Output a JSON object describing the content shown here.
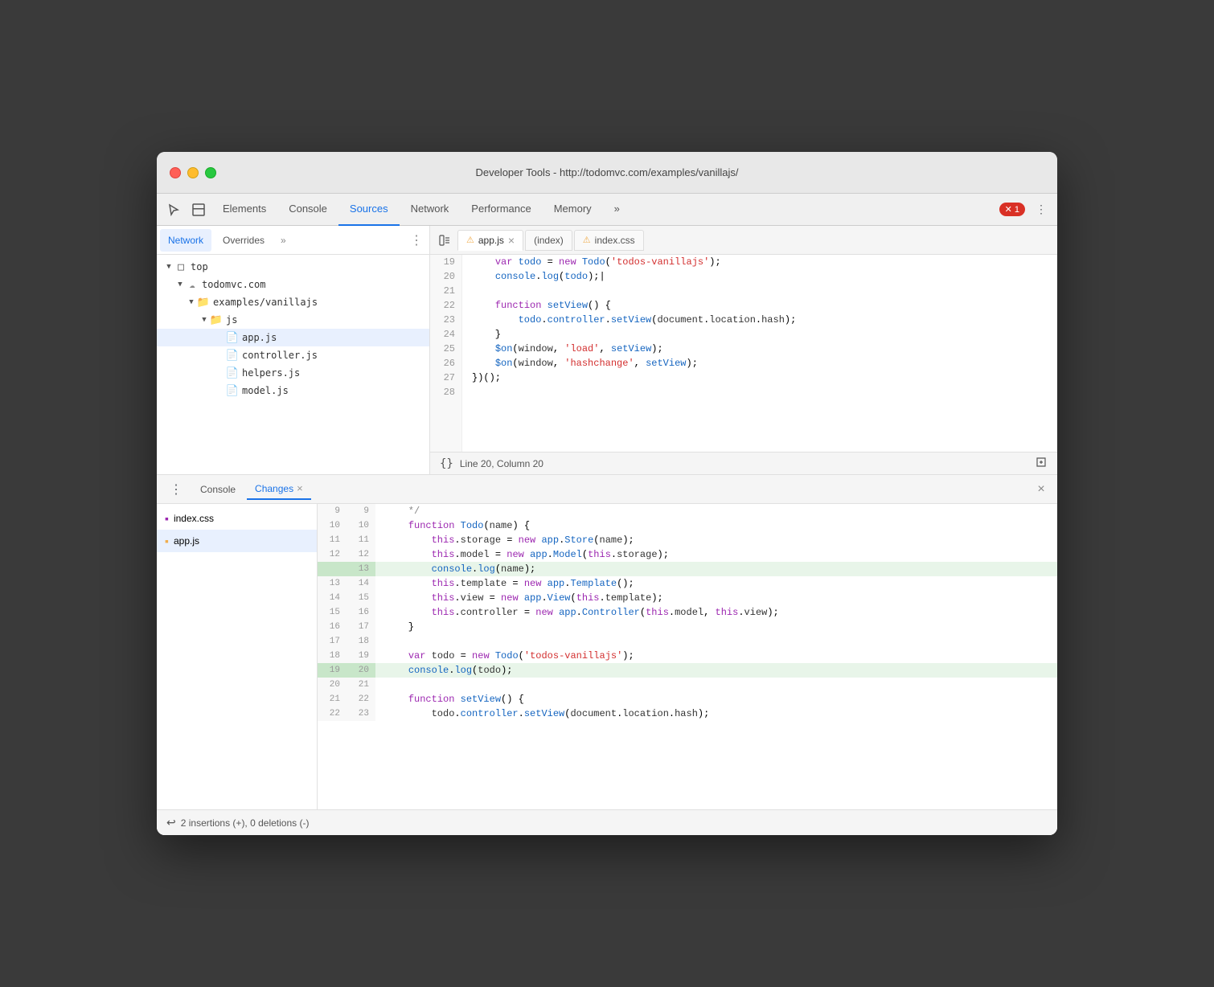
{
  "window": {
    "title": "Developer Tools - http://todomvc.com/examples/vanillajs/"
  },
  "traffic_lights": {
    "red": "close",
    "yellow": "minimize",
    "green": "maximize"
  },
  "main_tabs": [
    {
      "label": "Elements",
      "active": false
    },
    {
      "label": "Console",
      "active": false
    },
    {
      "label": "Sources",
      "active": true
    },
    {
      "label": "Network",
      "active": false
    },
    {
      "label": "Performance",
      "active": false
    },
    {
      "label": "Memory",
      "active": false
    },
    {
      "label": "»",
      "active": false
    }
  ],
  "error_badge": "1",
  "sources_panel_tabs": [
    {
      "label": "Network",
      "active": true
    },
    {
      "label": "Overrides",
      "active": false
    },
    {
      "label": "»",
      "active": false
    }
  ],
  "file_tree": {
    "top": {
      "label": "top",
      "expanded": true,
      "children": {
        "todomvc": {
          "label": "todomvc.com",
          "expanded": true,
          "children": {
            "examples": {
              "label": "examples/vanillajs",
              "expanded": true,
              "children": {
                "js": {
                  "label": "js",
                  "expanded": true,
                  "files": [
                    "app.js",
                    "controller.js",
                    "helpers.js",
                    "model.js"
                  ]
                }
              }
            }
          }
        }
      }
    }
  },
  "code_tabs": [
    {
      "label": "app.js",
      "warn": true,
      "active": true,
      "closeable": true
    },
    {
      "label": "(index)",
      "warn": false,
      "active": false,
      "closeable": false
    },
    {
      "label": "index.css",
      "warn": true,
      "active": false,
      "closeable": false
    }
  ],
  "code_lines": [
    {
      "num": 19,
      "content": "    var todo = new Todo('todos-vanillajs');"
    },
    {
      "num": 20,
      "content": "    console.log(todo);|"
    },
    {
      "num": 21,
      "content": ""
    },
    {
      "num": 22,
      "content": "    function setView() {"
    },
    {
      "num": 23,
      "content": "        todo.controller.setView(document.location.hash);"
    },
    {
      "num": 24,
      "content": "    }"
    },
    {
      "num": 25,
      "content": "    $on(window, 'load', setView);"
    },
    {
      "num": 26,
      "content": "    $on(window, 'hashchange', setView);"
    },
    {
      "num": 27,
      "content": "})();"
    },
    {
      "num": 28,
      "content": ""
    }
  ],
  "status_bar": {
    "line": "Line 20, Column 20"
  },
  "bottom_tabs": [
    {
      "label": "Console",
      "active": false
    },
    {
      "label": "Changes",
      "active": true,
      "closeable": true
    }
  ],
  "changed_files": [
    {
      "name": "index.css",
      "type": "css",
      "selected": false
    },
    {
      "name": "app.js",
      "type": "js",
      "selected": true
    }
  ],
  "diff_lines": [
    {
      "old_num": "9",
      "new_num": "9",
      "content": "    */",
      "added": false
    },
    {
      "old_num": "10",
      "new_num": "10",
      "content": "    function Todo(name) {",
      "added": false
    },
    {
      "old_num": "11",
      "new_num": "11",
      "content": "        this.storage = new app.Store(name);",
      "added": false
    },
    {
      "old_num": "12",
      "new_num": "12",
      "content": "        this.model = new app.Model(this.storage);",
      "added": false
    },
    {
      "old_num": "",
      "new_num": "13",
      "content": "        console.log(name);",
      "added": true
    },
    {
      "old_num": "13",
      "new_num": "14",
      "content": "        this.template = new app.Template();",
      "added": false
    },
    {
      "old_num": "14",
      "new_num": "15",
      "content": "        this.view = new app.View(this.template);",
      "added": false
    },
    {
      "old_num": "15",
      "new_num": "16",
      "content": "        this.controller = new app.Controller(this.model, this.view);",
      "added": false
    },
    {
      "old_num": "16",
      "new_num": "17",
      "content": "    }",
      "added": false
    },
    {
      "old_num": "17",
      "new_num": "18",
      "content": "",
      "added": false
    },
    {
      "old_num": "18",
      "new_num": "19",
      "content": "    var todo = new Todo('todos-vanillajs');",
      "added": false
    },
    {
      "old_num": "19",
      "new_num": "20",
      "content": "    console.log(todo);",
      "added": true
    },
    {
      "old_num": "20",
      "new_num": "21",
      "content": "",
      "added": false
    },
    {
      "old_num": "21",
      "new_num": "22",
      "content": "    function setView() {",
      "added": false
    },
    {
      "old_num": "22",
      "new_num": "23",
      "content": "        todo.controller.setView(document.location.hash);",
      "added": false
    }
  ],
  "bottom_status": "2 insertions (+), 0 deletions (-)"
}
